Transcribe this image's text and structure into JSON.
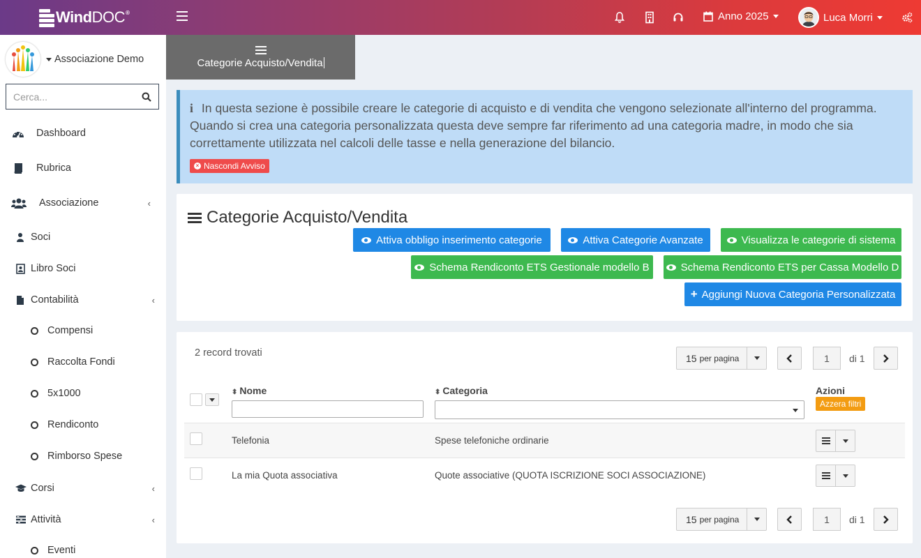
{
  "topbar": {
    "logo_main": "Wind",
    "logo_doc": "DOC",
    "logo_reg": "®",
    "year_label": "Anno 2025",
    "user_name": "Luca Morri",
    "icons": [
      "bell-icon",
      "building-icon",
      "headset-icon",
      "calendar-icon",
      "cogs-icon"
    ]
  },
  "sidebar": {
    "org_name": "Associazione Demo",
    "search_placeholder": "Cerca...",
    "items": [
      {
        "label": "Dashboard",
        "icon": "dashboard-icon"
      },
      {
        "label": "Rubrica",
        "icon": "book-icon"
      },
      {
        "label": "Associazione",
        "icon": "users-icon"
      },
      {
        "label": "Soci",
        "icon": "user-icon"
      },
      {
        "label": "Libro Soci",
        "icon": "address-book-icon"
      },
      {
        "label": "Contabilità",
        "icon": "file-icon"
      },
      {
        "label": "Compensi",
        "icon": "circle-icon"
      },
      {
        "label": "Raccolta Fondi",
        "icon": "circle-icon"
      },
      {
        "label": "5x1000",
        "icon": "circle-icon"
      },
      {
        "label": "Rendiconto",
        "icon": "circle-icon"
      },
      {
        "label": "Rimborso Spese",
        "icon": "circle-icon"
      },
      {
        "label": "Corsi",
        "icon": "graduation-cap-icon"
      },
      {
        "label": "Attività",
        "icon": "tasks-icon"
      },
      {
        "label": "Eventi",
        "icon": "circle-icon"
      }
    ]
  },
  "page_tab": {
    "title": "Categorie Acquisto/Vendita"
  },
  "alert": {
    "icon": "i",
    "text": "In questa sezione è possibile creare le categorie di acquisto e di vendita che vengono selezionate all'interno del programma. Quando si crea una categoria personalizzata questa deve sempre far riferimento ad una categoria madre, in modo che sia correttamente utilizzata nel calcoli delle tasse e nella generazione del bilancio.",
    "hide_button": "Nascondi Avviso"
  },
  "panel": {
    "title": "Categorie Acquisto/Vendita",
    "buttons": {
      "obbligo": "Attiva obbligo inserimento categorie",
      "avanzate": "Attiva Categorie Avanzate",
      "sistema": "Visualizza le categorie di sistema",
      "schema_b": "Schema Rendiconto ETS Gestionale modello B",
      "schema_d": "Schema Rendiconto ETS per Cassa Modello D",
      "aggiungi": "Aggiungi Nuova Categoria Personalizzata"
    }
  },
  "table": {
    "records_found": "2 record trovati",
    "per_page_num": "15",
    "per_page_label": "per pagina",
    "page": "1",
    "of_pages": "di 1",
    "columns": {
      "nome": "Nome",
      "categoria": "Categoria",
      "azioni": "Azioni"
    },
    "reset_filters": "Azzera filtri",
    "rows": [
      {
        "nome": "Telefonia",
        "categoria": "Spese telefoniche ordinarie"
      },
      {
        "nome": "La mia Quota associativa",
        "categoria": "Quote associative (QUOTA ISCRIZIONE SOCI ASSOCIAZIONE)"
      }
    ]
  }
}
